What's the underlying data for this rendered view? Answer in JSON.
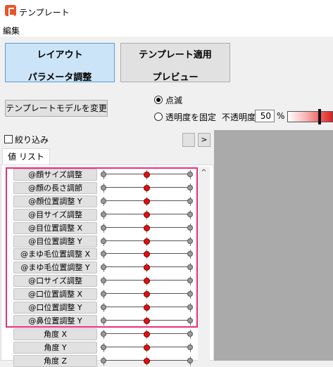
{
  "window": {
    "title": "テンプレート"
  },
  "menu": {
    "items": [
      "編集"
    ]
  },
  "modes": {
    "layout": {
      "line1": "レイアウト",
      "line2": "パラメータ調整"
    },
    "apply": {
      "line1": "テンプレート適用",
      "line2": "プレビュー"
    }
  },
  "model_button": "テンプレートモデルを変更",
  "display": {
    "blink_label": "点滅",
    "transparency_label": "透明度を固定",
    "selected": "blink",
    "opacity_label": "不透明度",
    "opacity_value": "50",
    "opacity_unit": "%"
  },
  "filter": {
    "label": "絞り込み",
    "next_button": ">"
  },
  "tabs": [
    "値 リスト"
  ],
  "params": [
    "@顔サイズ調整",
    "@顔の長さ調節",
    "@顔位置調整 Y",
    "@目サイズ調整",
    "@目位置調整 X",
    "@目位置調整 Y",
    "@まゆ毛位置調整 X",
    "@まゆ毛位置調整 Y",
    "@口サイズ調整",
    "@口位置調整 X",
    "@口位置調整 Y",
    "@鼻位置調整 Y",
    "角度 X",
    "角度 Y",
    "角度 Z"
  ],
  "colors": {
    "highlight": "#e8307a",
    "selected_mode": "#cce4f7",
    "knob": "#e01010"
  }
}
